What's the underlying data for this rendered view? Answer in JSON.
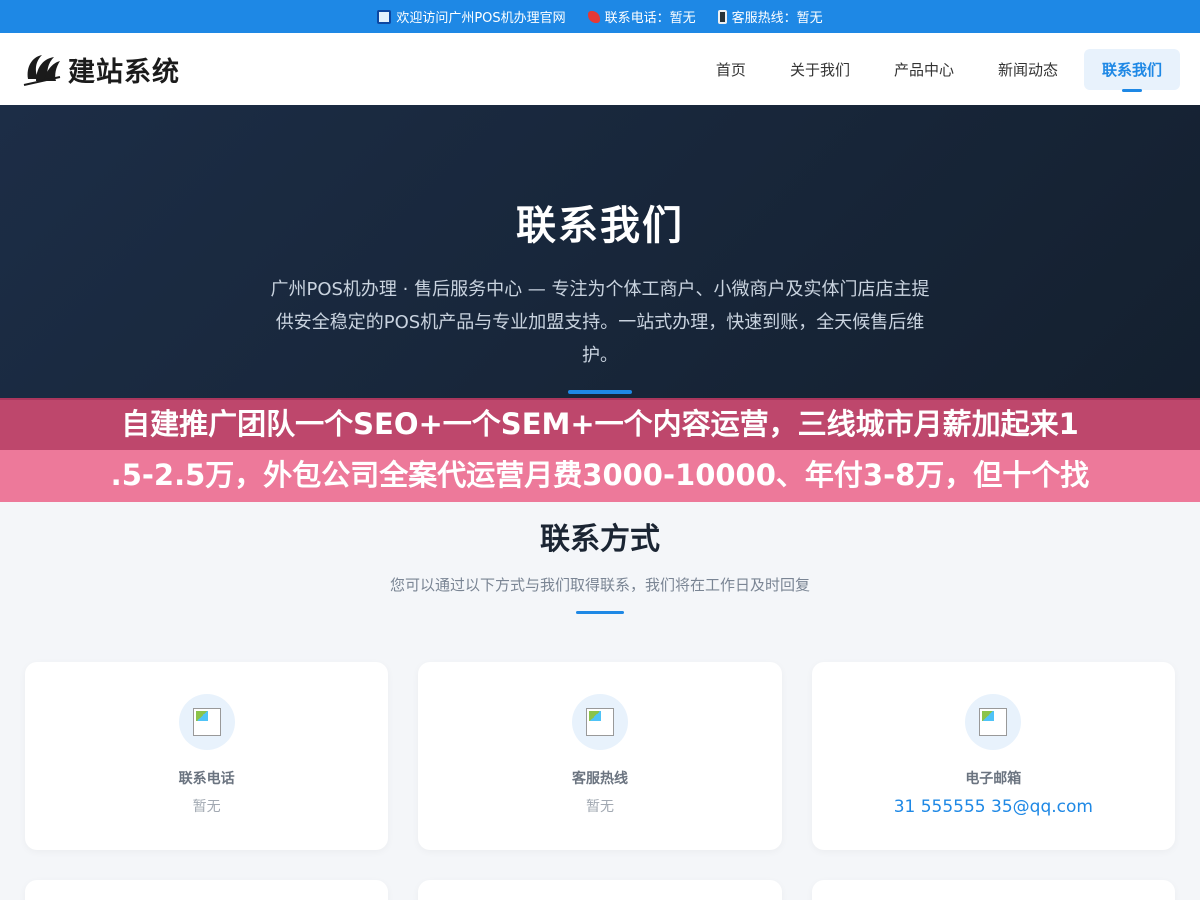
{
  "topbar": {
    "welcome": "欢迎访问广州POS机办理官网",
    "phone_label": "联系电话：暂无",
    "hotline_label": "客服热线：暂无"
  },
  "header": {
    "logo_text": "建站系统",
    "nav": [
      {
        "label": "首页",
        "active": false
      },
      {
        "label": "关于我们",
        "active": false
      },
      {
        "label": "产品中心",
        "active": false
      },
      {
        "label": "新闻动态",
        "active": false
      },
      {
        "label": "联系我们",
        "active": true
      }
    ]
  },
  "hero": {
    "title": "联系我们",
    "description": "广州POS机办理 · 售后服务中心 — 专注为个体工商户、小微商户及实体门店店主提供安全稳定的POS机产品与专业加盟支持。一站式办理，快速到账，全天候售后维护。"
  },
  "caption": {
    "line1": "自建推广团队一个SEO+一个SEM+一个内容运营，三线城市月薪加起来1",
    "line2": ".5-2.5万，外包公司全案代运营月费3000-10000、年付3-8万，但十个找"
  },
  "contact": {
    "title": "联系方式",
    "subtitle": "您可以通过以下方式与我们取得联系，我们将在工作日及时回复",
    "cards": [
      {
        "icon_alt": "电",
        "label": "联系电话",
        "value": "暂无",
        "is_link": false
      },
      {
        "icon_alt": "客",
        "label": "客服热线",
        "value": "暂无",
        "is_link": false
      },
      {
        "icon_alt": "邮",
        "label": "电子邮箱",
        "value": "31 555555 35@qq.com",
        "is_link": true
      }
    ]
  },
  "colors": {
    "accent": "#1e88e5",
    "hero_bg": "#1c2d46",
    "caption_top": "#b9375f",
    "caption_bottom": "#ec6e91"
  }
}
